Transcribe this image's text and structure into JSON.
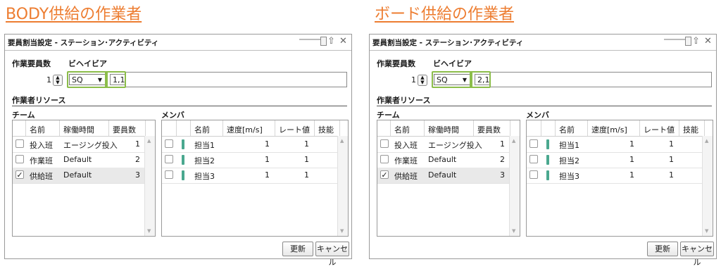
{
  "captions": {
    "left": "BODY供給の作業者",
    "right": "ボード供給の作業者"
  },
  "panels": [
    {
      "title": "要員割当設定 - ステーション･アクティビティ",
      "staff_count_label": "作業要員数",
      "behavior_label": "ビヘイビア",
      "staff_count": "1",
      "behavior_select": "SQ",
      "behavior_value": "1,1",
      "resource_label": "作業者リソース",
      "team_label": "チーム",
      "member_label": "メンバ",
      "team_headers": [
        "名前",
        "稼働時間",
        "要員数"
      ],
      "teams": [
        {
          "name": "投入班",
          "time": "エージング投入",
          "count": "1",
          "checked": ""
        },
        {
          "name": "作業班",
          "time": "Default",
          "count": "2",
          "checked": ""
        },
        {
          "name": "供給班",
          "time": "Default",
          "count": "3",
          "checked": "✓"
        }
      ],
      "member_headers": [
        "名前",
        "速度[m/s]",
        "レート値",
        "技能"
      ],
      "members": [
        {
          "name": "担当1",
          "speed": "1",
          "rate": "1"
        },
        {
          "name": "担当2",
          "speed": "1",
          "rate": "1"
        },
        {
          "name": "担当3",
          "speed": "1",
          "rate": "1"
        }
      ],
      "update_label": "更新",
      "cancel_label": "キャンセル"
    },
    {
      "title": "要員割当設定 - ステーション･アクティビティ",
      "staff_count_label": "作業要員数",
      "behavior_label": "ビヘイビア",
      "staff_count": "1",
      "behavior_select": "SQ",
      "behavior_value": "2,1",
      "resource_label": "作業者リソース",
      "team_label": "チーム",
      "member_label": "メンバ",
      "team_headers": [
        "名前",
        "稼働時間",
        "要員数"
      ],
      "teams": [
        {
          "name": "投入班",
          "time": "エージング投入",
          "count": "1",
          "checked": ""
        },
        {
          "name": "作業班",
          "time": "Default",
          "count": "2",
          "checked": ""
        },
        {
          "name": "供給班",
          "time": "Default",
          "count": "3",
          "checked": "✓"
        }
      ],
      "member_headers": [
        "名前",
        "速度[m/s]",
        "レート値",
        "技能"
      ],
      "members": [
        {
          "name": "担当1",
          "speed": "1",
          "rate": "1"
        },
        {
          "name": "担当2",
          "speed": "1",
          "rate": "1"
        },
        {
          "name": "担当3",
          "speed": "1",
          "rate": "1"
        }
      ],
      "update_label": "更新",
      "cancel_label": "キャンセル"
    }
  ],
  "colors": {
    "caption": "#ed7d31",
    "highlight": "#8cbd4a",
    "info_icon": "#4aa88f"
  }
}
